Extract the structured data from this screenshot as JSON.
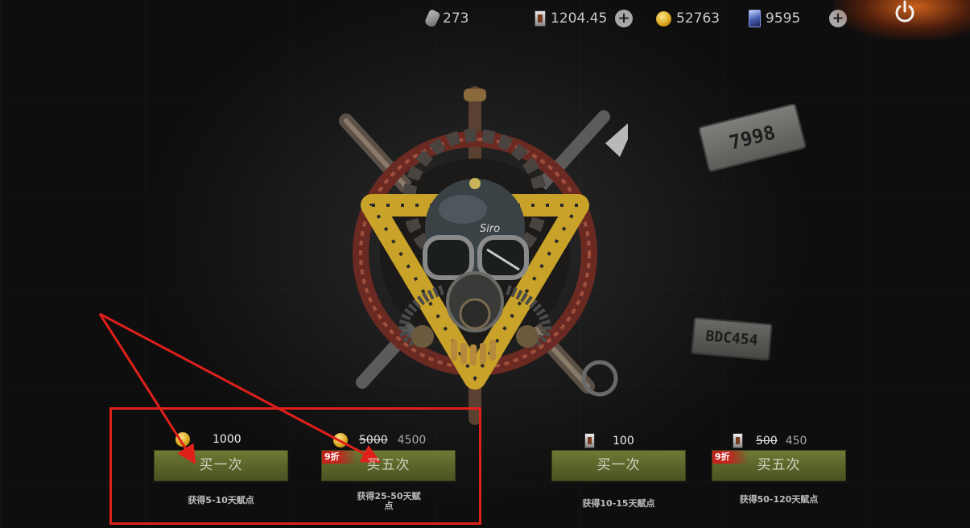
{
  "topbar": {
    "resources": [
      {
        "icon": "grenade-icon",
        "value": "273"
      },
      {
        "icon": "ticket-icon",
        "value": "1204.45"
      },
      {
        "icon": "gold-coin-icon",
        "value": "52763"
      },
      {
        "icon": "card-icon",
        "value": "9595"
      }
    ],
    "power_icon": "power-icon"
  },
  "plates": {
    "plate_1": "7998",
    "plate_2": "BDC454"
  },
  "emblem_text": "Siro",
  "offers": [
    {
      "currency": "gold-coin",
      "price": "1000",
      "button": "买一次",
      "desc": "获得5-10天赋点"
    },
    {
      "currency": "gold-coin",
      "old_price": "5000",
      "price": "4500",
      "discount": "9折",
      "button": "买五次",
      "desc": "获得25-50天赋点"
    },
    {
      "currency": "ticket",
      "price": "100",
      "button": "买一次",
      "desc": "获得10-15天赋点"
    },
    {
      "currency": "ticket",
      "old_price": "500",
      "price": "450",
      "discount": "9折",
      "button": "买五次",
      "desc": "获得50-120天赋点"
    }
  ],
  "colors": {
    "button_green": "#59632a",
    "discount_red": "#c2231c",
    "annotation_red": "#e0201a",
    "power_glow": "#eb6e1e"
  }
}
